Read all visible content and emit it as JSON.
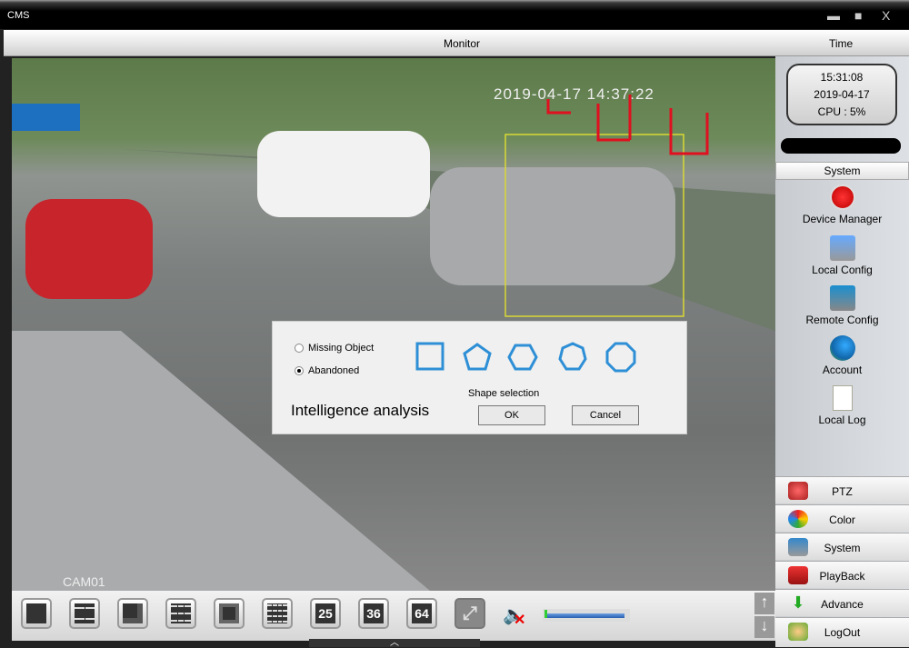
{
  "window": {
    "title": "CMS",
    "minimize": "▬",
    "maximize": "■",
    "close": "X"
  },
  "header": {
    "monitor": "Monitor",
    "time": "Time"
  },
  "video": {
    "timestamp": "2019-04-17  14:37:22",
    "channel": "CAM01"
  },
  "clock": {
    "time": "15:31:08",
    "date": "2019-04-17",
    "cpu": "CPU : 5%"
  },
  "system": {
    "heading": "System",
    "items": [
      {
        "label": "Device Manager",
        "icon": "device-manager-icon"
      },
      {
        "label": "Local Config",
        "icon": "local-config-icon"
      },
      {
        "label": "Remote Config",
        "icon": "remote-config-icon"
      },
      {
        "label": "Account",
        "icon": "account-icon"
      },
      {
        "label": "Local Log",
        "icon": "local-log-icon"
      }
    ]
  },
  "nav": [
    {
      "label": "PTZ"
    },
    {
      "label": "Color"
    },
    {
      "label": "System"
    },
    {
      "label": "PlayBack"
    },
    {
      "label": "Advance"
    },
    {
      "label": "LogOut"
    }
  ],
  "toolbar": {
    "layouts": [
      "1",
      "4",
      "6",
      "9",
      "8",
      "16",
      "25",
      "36",
      "64"
    ],
    "volume": 0.02
  },
  "dialog": {
    "title": "Intelligence analysis",
    "options": [
      {
        "label": "Missing Object",
        "checked": false
      },
      {
        "label": "Abandoned",
        "checked": true
      }
    ],
    "shape_label": "Shape selection",
    "ok": "OK",
    "cancel": "Cancel",
    "shape_color": "#2e8fd6"
  }
}
